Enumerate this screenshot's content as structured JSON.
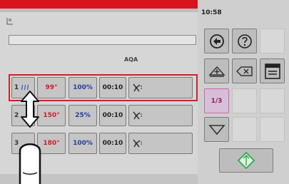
{
  "header": {
    "time": "10:58"
  },
  "recipe": {
    "name_label": "AQA",
    "name_value": ""
  },
  "rows": [
    {
      "num": "1",
      "temp": "99°",
      "pct": "100%",
      "time": "00:10",
      "selected": true
    },
    {
      "num": "2",
      "temp": "150°",
      "pct": "25%",
      "time": "00:10",
      "selected": false
    },
    {
      "num": "3",
      "temp": "180°",
      "pct": "100%",
      "time": "00:10",
      "selected": false
    }
  ],
  "toolbar": {
    "page": "1/3"
  },
  "icons": {
    "recipe": "recipe-book-icon",
    "back": "back-arrow-circle-icon",
    "help": "question-circle-icon",
    "add": "add-step-triangle-icon",
    "delete": "backspace-icon",
    "save": "save-window-icon",
    "down": "scroll-down-icon",
    "start": "start-diamond-icon",
    "fan": "fan-icon",
    "steam": "steam-icon"
  },
  "colors": {
    "accent_red": "#d8141d",
    "temp_red": "#d21c25",
    "pct_blue": "#243fa0",
    "page_pink": "#c86aa0",
    "start_green": "#2fa84f"
  }
}
